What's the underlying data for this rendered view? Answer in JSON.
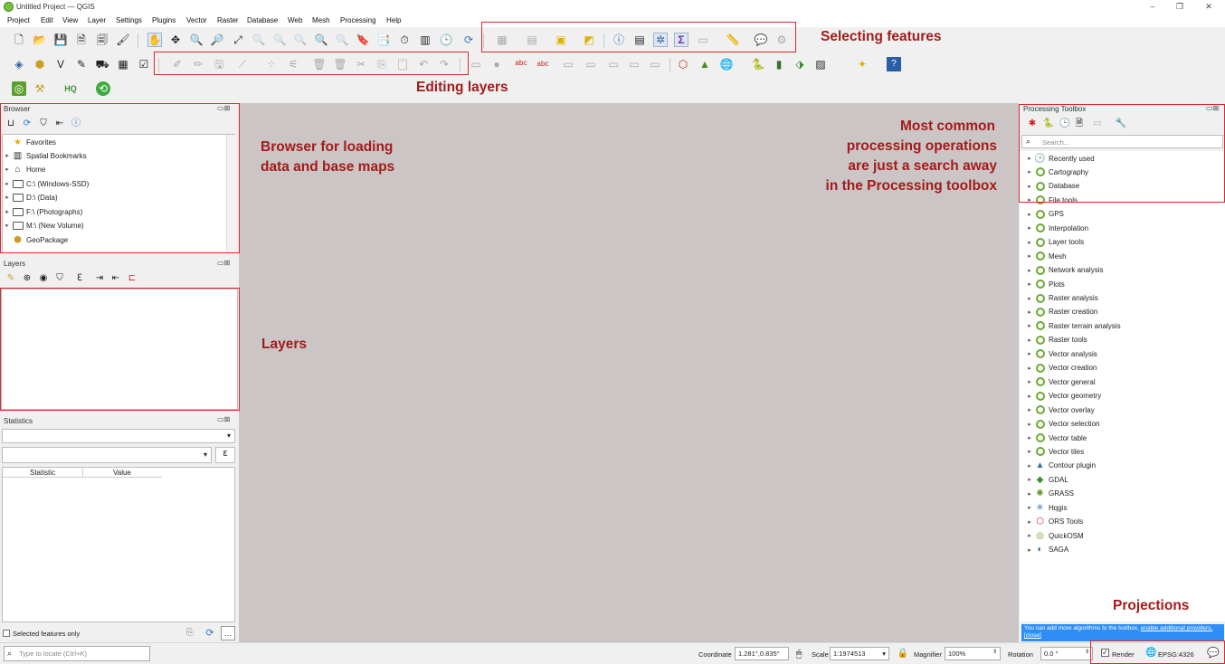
{
  "window": {
    "title": "Untitled Project — QGIS",
    "min": "–",
    "restore": "❐",
    "close": "✕"
  },
  "menu": [
    "Project",
    "Edit",
    "View",
    "Layer",
    "Settings",
    "Plugins",
    "Vector",
    "Raster",
    "Database",
    "Web",
    "Mesh",
    "Processing",
    "Help"
  ],
  "annotations": {
    "selecting": "Selecting features",
    "editing": "Editing layers",
    "browser_line1": "Browser for loading",
    "browser_line2": "data and base maps",
    "layers": "Layers",
    "processing_line1": "Most common",
    "processing_line2": "processing operations",
    "processing_line3": "are just a search away",
    "processing_line4": "in the Processing toolbox",
    "projections": "Projections"
  },
  "browser": {
    "title": "Browser",
    "items": [
      {
        "label": "Favorites",
        "icon": "star-icon"
      },
      {
        "label": "Spatial Bookmarks",
        "icon": "bookmark-icon"
      },
      {
        "label": "Home",
        "icon": "home-icon"
      },
      {
        "label": "C:\\ (Windows-SSD)",
        "icon": "folder-icon"
      },
      {
        "label": "D:\\ (Data)",
        "icon": "folder-icon"
      },
      {
        "label": "F:\\ (Photographs)",
        "icon": "folder-icon"
      },
      {
        "label": "M:\\ (New Volume)",
        "icon": "folder-icon"
      },
      {
        "label": "GeoPackage",
        "icon": "geopackage-icon"
      }
    ]
  },
  "layers_panel": {
    "title": "Layers"
  },
  "statistics": {
    "title": "Statistics",
    "columns": [
      "Statistic",
      "Value"
    ],
    "expression_button": "ε",
    "selected_only": "Selected features only"
  },
  "processing": {
    "title": "Processing Toolbox",
    "search_placeholder": "Search...",
    "groups": [
      "Recently used",
      "Cartography",
      "Database",
      "File tools",
      "GPS",
      "Interpolation",
      "Layer tools",
      "Mesh",
      "Network analysis",
      "Plots",
      "Raster analysis",
      "Raster creation",
      "Raster terrain analysis",
      "Raster tools",
      "Vector analysis",
      "Vector creation",
      "Vector general",
      "Vector geometry",
      "Vector overlay",
      "Vector selection",
      "Vector table",
      "Vector tiles",
      "Contour plugin",
      "GDAL",
      "GRASS",
      "Hqgis",
      "ORS Tools",
      "QuickOSM",
      "SAGA"
    ],
    "info_text": "You can add more algorithms to the toolbox, ",
    "info_link": "enable additional providers.",
    "info_close": "[close]"
  },
  "statusbar": {
    "locator_placeholder": "Type to locate (Ctrl+K)",
    "coordinate_label": "Coordinate",
    "coordinate_value": "1.281°,0.835°",
    "scale_label": "Scale",
    "scale_value": "1:1974513",
    "magnifier_label": "Magnifier",
    "magnifier_value": "100%",
    "rotation_label": "Rotation",
    "rotation_value": "0.0 °",
    "render_label": "Render",
    "crs": "EPSG:4326"
  },
  "colors": {
    "annotation": "#a31b1b",
    "canvas": "#ccc5c5",
    "qgis_green": "#6aaa2f"
  }
}
